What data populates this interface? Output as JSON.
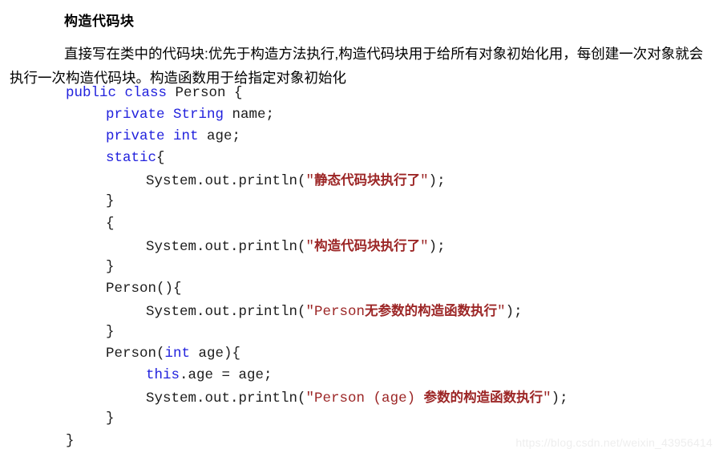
{
  "document": {
    "title": "构造代码块",
    "paragraph": "直接写在类中的代码块:优先于构造方法执行,构造代码块用于给所有对象初始化用，每创建一次对象就会执行一次构造代码块。构造函数用于给指定对象初始化",
    "watermark": "https://blog.csdn.net/weixin_43956414"
  },
  "colors": {
    "keyword": "#2222dd",
    "string": "#9c2626",
    "plain": "#1c1c1c",
    "background": "#ffffff",
    "watermark": "#eeeeee"
  },
  "code": {
    "language": "Java",
    "lines": [
      {
        "indent": 0,
        "tokens": [
          {
            "t": "public",
            "k": "kw"
          },
          {
            "t": " ",
            "k": "pln"
          },
          {
            "t": "class",
            "k": "kw"
          },
          {
            "t": " Person {",
            "k": "pln"
          }
        ]
      },
      {
        "indent": 1,
        "tokens": [
          {
            "t": "private",
            "k": "kw"
          },
          {
            "t": " ",
            "k": "pln"
          },
          {
            "t": "String",
            "k": "kw"
          },
          {
            "t": " name;",
            "k": "pln"
          }
        ]
      },
      {
        "indent": 1,
        "tokens": [
          {
            "t": "private",
            "k": "kw"
          },
          {
            "t": " ",
            "k": "pln"
          },
          {
            "t": "int",
            "k": "kw"
          },
          {
            "t": " age;",
            "k": "pln"
          }
        ]
      },
      {
        "indent": 1,
        "tokens": [
          {
            "t": "static",
            "k": "kw"
          },
          {
            "t": "{",
            "k": "pln"
          }
        ]
      },
      {
        "indent": 2,
        "tokens": [
          {
            "t": "System.out.println(",
            "k": "pln"
          },
          {
            "t": "\"",
            "k": "str"
          },
          {
            "t": "静态代码块执行了",
            "k": "str cjk"
          },
          {
            "t": "\"",
            "k": "str"
          },
          {
            "t": ");",
            "k": "pln"
          }
        ]
      },
      {
        "indent": 1,
        "tokens": [
          {
            "t": "}",
            "k": "pln"
          }
        ]
      },
      {
        "indent": 1,
        "tokens": [
          {
            "t": "{",
            "k": "pln"
          }
        ]
      },
      {
        "indent": 2,
        "tokens": [
          {
            "t": "System.out.println(",
            "k": "pln"
          },
          {
            "t": "\"",
            "k": "str"
          },
          {
            "t": "构造代码块执行了",
            "k": "str cjk"
          },
          {
            "t": "\"",
            "k": "str"
          },
          {
            "t": ");",
            "k": "pln"
          }
        ]
      },
      {
        "indent": 1,
        "tokens": [
          {
            "t": "}",
            "k": "pln"
          }
        ]
      },
      {
        "indent": 1,
        "tokens": [
          {
            "t": "Person(){",
            "k": "pln"
          }
        ]
      },
      {
        "indent": 2,
        "tokens": [
          {
            "t": "System.out.println(",
            "k": "pln"
          },
          {
            "t": "\"Person",
            "k": "str"
          },
          {
            "t": "无参数的构造函数执行",
            "k": "str cjk"
          },
          {
            "t": "\"",
            "k": "str"
          },
          {
            "t": ");",
            "k": "pln"
          }
        ]
      },
      {
        "indent": 1,
        "tokens": [
          {
            "t": "}",
            "k": "pln"
          }
        ]
      },
      {
        "indent": 1,
        "tokens": [
          {
            "t": "Person(",
            "k": "pln"
          },
          {
            "t": "int",
            "k": "kw"
          },
          {
            "t": " age){",
            "k": "pln"
          }
        ]
      },
      {
        "indent": 2,
        "tokens": [
          {
            "t": "this",
            "k": "kw"
          },
          {
            "t": ".age = age;",
            "k": "pln"
          }
        ]
      },
      {
        "indent": 2,
        "tokens": [
          {
            "t": "System.out.println(",
            "k": "pln"
          },
          {
            "t": "\"Person (age) ",
            "k": "str"
          },
          {
            "t": "参数的构造函数执行",
            "k": "str cjk"
          },
          {
            "t": "\"",
            "k": "str"
          },
          {
            "t": ");",
            "k": "pln"
          }
        ]
      },
      {
        "indent": 1,
        "tokens": [
          {
            "t": "}",
            "k": "pln"
          }
        ]
      },
      {
        "indent": 0,
        "tokens": [
          {
            "t": "}",
            "k": "pln"
          }
        ]
      }
    ]
  }
}
